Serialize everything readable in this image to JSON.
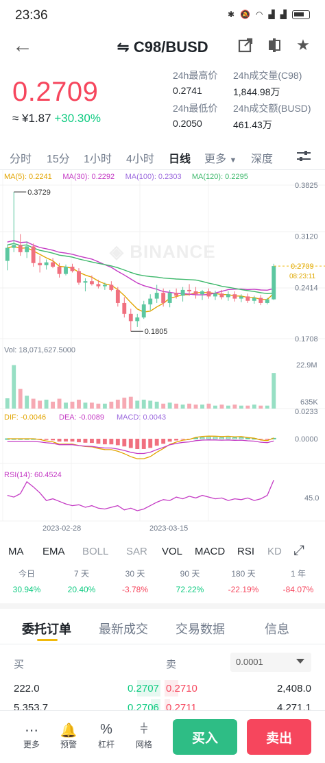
{
  "status_bar": {
    "time": "23:36",
    "icons": [
      "bluetooth-icon",
      "mute-icon",
      "wifi-icon",
      "signal-4g-icon",
      "signal-4g-icon",
      "battery-icon"
    ]
  },
  "header": {
    "title": "C98/BUSD",
    "swap_symbol": "⇋"
  },
  "price": {
    "last": "0.2709",
    "cny": "≈ ¥1.87",
    "change": "+30.30%"
  },
  "stats": {
    "high_label": "24h最高价",
    "high": "0.2741",
    "low_label": "24h最低价",
    "low": "0.2050",
    "vol_label": "24h成交量(C98)",
    "vol": "1,844.98万",
    "amt_label": "24h成交额(BUSD)",
    "amt": "461.43万"
  },
  "timeframes": [
    "分时",
    "15分",
    "1小时",
    "4小时",
    "日线",
    "更多",
    "深度"
  ],
  "active_timeframe": "日线",
  "chart_data": {
    "type": "candlestick",
    "ma_legend": [
      {
        "name": "MA(5): 0.2241",
        "color": "#e2a400"
      },
      {
        "name": "MA(30): 0.2292",
        "color": "#c43ac4"
      },
      {
        "name": "MA(100): 0.2303",
        "color": "#9c6ade"
      },
      {
        "name": "MA(120): 0.2295",
        "color": "#3db86b"
      }
    ],
    "y_ticks": [
      "0.3825",
      "0.3120",
      "0.2414",
      "0.1708"
    ],
    "y_range": [
      0.1708,
      0.3825
    ],
    "high_marker": "0.3729",
    "low_marker": "0.1805",
    "current_price": "0.2709",
    "countdown": "08:23:11",
    "watermark": "BINANCE",
    "candles": [
      {
        "o": 0.278,
        "h": 0.3,
        "l": 0.265,
        "c": 0.296
      },
      {
        "o": 0.296,
        "h": 0.373,
        "l": 0.29,
        "c": 0.3
      },
      {
        "o": 0.3,
        "h": 0.315,
        "l": 0.285,
        "c": 0.29
      },
      {
        "o": 0.29,
        "h": 0.305,
        "l": 0.282,
        "c": 0.298
      },
      {
        "o": 0.298,
        "h": 0.302,
        "l": 0.27,
        "c": 0.275
      },
      {
        "o": 0.275,
        "h": 0.285,
        "l": 0.262,
        "c": 0.272
      },
      {
        "o": 0.272,
        "h": 0.28,
        "l": 0.266,
        "c": 0.276
      },
      {
        "o": 0.276,
        "h": 0.282,
        "l": 0.268,
        "c": 0.27
      },
      {
        "o": 0.27,
        "h": 0.275,
        "l": 0.255,
        "c": 0.26
      },
      {
        "o": 0.26,
        "h": 0.273,
        "l": 0.258,
        "c": 0.27
      },
      {
        "o": 0.27,
        "h": 0.274,
        "l": 0.262,
        "c": 0.264
      },
      {
        "o": 0.264,
        "h": 0.268,
        "l": 0.245,
        "c": 0.248
      },
      {
        "o": 0.248,
        "h": 0.254,
        "l": 0.236,
        "c": 0.25
      },
      {
        "o": 0.25,
        "h": 0.258,
        "l": 0.244,
        "c": 0.246
      },
      {
        "o": 0.246,
        "h": 0.252,
        "l": 0.24,
        "c": 0.243
      },
      {
        "o": 0.243,
        "h": 0.248,
        "l": 0.238,
        "c": 0.245
      },
      {
        "o": 0.245,
        "h": 0.25,
        "l": 0.236,
        "c": 0.238
      },
      {
        "o": 0.238,
        "h": 0.242,
        "l": 0.215,
        "c": 0.22
      },
      {
        "o": 0.22,
        "h": 0.228,
        "l": 0.2,
        "c": 0.205
      },
      {
        "o": 0.205,
        "h": 0.212,
        "l": 0.181,
        "c": 0.195
      },
      {
        "o": 0.195,
        "h": 0.205,
        "l": 0.187,
        "c": 0.2
      },
      {
        "o": 0.2,
        "h": 0.223,
        "l": 0.198,
        "c": 0.218
      },
      {
        "o": 0.218,
        "h": 0.232,
        "l": 0.21,
        "c": 0.226
      },
      {
        "o": 0.226,
        "h": 0.245,
        "l": 0.22,
        "c": 0.234
      },
      {
        "o": 0.234,
        "h": 0.24,
        "l": 0.215,
        "c": 0.22
      },
      {
        "o": 0.22,
        "h": 0.238,
        "l": 0.214,
        "c": 0.234
      },
      {
        "o": 0.234,
        "h": 0.24,
        "l": 0.226,
        "c": 0.23
      },
      {
        "o": 0.23,
        "h": 0.242,
        "l": 0.222,
        "c": 0.238
      },
      {
        "o": 0.238,
        "h": 0.246,
        "l": 0.23,
        "c": 0.236
      },
      {
        "o": 0.236,
        "h": 0.242,
        "l": 0.226,
        "c": 0.232
      },
      {
        "o": 0.232,
        "h": 0.238,
        "l": 0.224,
        "c": 0.236
      },
      {
        "o": 0.236,
        "h": 0.24,
        "l": 0.226,
        "c": 0.229
      },
      {
        "o": 0.229,
        "h": 0.237,
        "l": 0.224,
        "c": 0.233
      },
      {
        "o": 0.233,
        "h": 0.238,
        "l": 0.225,
        "c": 0.228
      },
      {
        "o": 0.228,
        "h": 0.236,
        "l": 0.223,
        "c": 0.232
      },
      {
        "o": 0.232,
        "h": 0.236,
        "l": 0.222,
        "c": 0.226
      },
      {
        "o": 0.226,
        "h": 0.232,
        "l": 0.221,
        "c": 0.229
      },
      {
        "o": 0.229,
        "h": 0.233,
        "l": 0.22,
        "c": 0.223
      },
      {
        "o": 0.223,
        "h": 0.23,
        "l": 0.219,
        "c": 0.227
      },
      {
        "o": 0.227,
        "h": 0.231,
        "l": 0.217,
        "c": 0.22
      },
      {
        "o": 0.22,
        "h": 0.227,
        "l": 0.218,
        "c": 0.225
      },
      {
        "o": 0.225,
        "h": 0.274,
        "l": 0.224,
        "c": 0.2709
      }
    ],
    "volume": {
      "label": "Vol: 18,071,627.5000",
      "y_ticks": [
        "22.9M",
        "635K"
      ],
      "values": [
        5.2,
        22.0,
        10.0,
        6.5,
        5.0,
        4.0,
        4.5,
        3.5,
        5.0,
        3.0,
        3.5,
        4.5,
        3.0,
        3.0,
        2.5,
        2.5,
        3.5,
        4.5,
        5.5,
        6.0,
        4.0,
        4.5,
        4.0,
        3.5,
        2.5,
        3.0,
        2.5,
        2.0,
        2.5,
        2.0,
        2.0,
        2.5,
        1.5,
        2.0,
        1.5,
        2.0,
        1.5,
        1.5,
        2.0,
        1.5,
        1.5,
        18.0
      ]
    },
    "macd": {
      "label_dif": "DIF: -0.0046",
      "label_dea": "DEA: -0.0089",
      "label_macd": "MACD: 0.0043",
      "y_ticks": [
        "0.0233",
        "0.0000"
      ]
    },
    "rsi": {
      "label": "RSI(14): 60.4524",
      "y_ticks": [
        "45.0"
      ],
      "values": [
        42,
        40,
        44,
        58,
        52,
        45,
        36,
        38,
        35,
        32,
        30,
        31,
        28,
        30,
        27,
        26,
        28,
        30,
        25,
        27,
        24,
        26,
        30,
        34,
        37,
        36,
        40,
        38,
        41,
        39,
        42,
        40,
        38,
        39,
        36,
        38,
        37,
        39,
        36,
        38,
        42,
        60
      ]
    },
    "x_labels": [
      "2023-02-28",
      "2023-03-15"
    ]
  },
  "indicators": [
    "MA",
    "EMA",
    "BOLL",
    "SAR",
    "VOL",
    "MACD",
    "RSI",
    "KD"
  ],
  "performance": [
    {
      "label": "今日",
      "value": "30.94%",
      "dir": "up"
    },
    {
      "label": "7 天",
      "value": "20.40%",
      "dir": "up"
    },
    {
      "label": "30 天",
      "value": "-3.78%",
      "dir": "down"
    },
    {
      "label": "90 天",
      "value": "72.22%",
      "dir": "up"
    },
    {
      "label": "180 天",
      "value": "-22.19%",
      "dir": "down"
    },
    {
      "label": "1 年",
      "value": "-84.07%",
      "dir": "down"
    }
  ],
  "order_tabs": [
    "委托订单",
    "最新成交",
    "交易数据",
    "信息"
  ],
  "orderbook": {
    "buy_label": "买",
    "sell_label": "卖",
    "precision": "0.0001",
    "rows": [
      {
        "bid_qty": "222.0",
        "bid_price": "0.2707",
        "ask_price": "0.2710",
        "ask_qty": "2,408.0"
      },
      {
        "bid_qty": "5,353.7",
        "bid_price": "0.2706",
        "ask_price": "0.2711",
        "ask_qty": "4,271.1"
      }
    ]
  },
  "bottom_nav": [
    {
      "label": "更多",
      "icon": "more-icon"
    },
    {
      "label": "预警",
      "icon": "bell-icon"
    },
    {
      "label": "杠杆",
      "icon": "leverage-icon"
    },
    {
      "label": "网格",
      "icon": "grid-icon"
    }
  ],
  "buy_button": "买入",
  "sell_button": "卖出"
}
